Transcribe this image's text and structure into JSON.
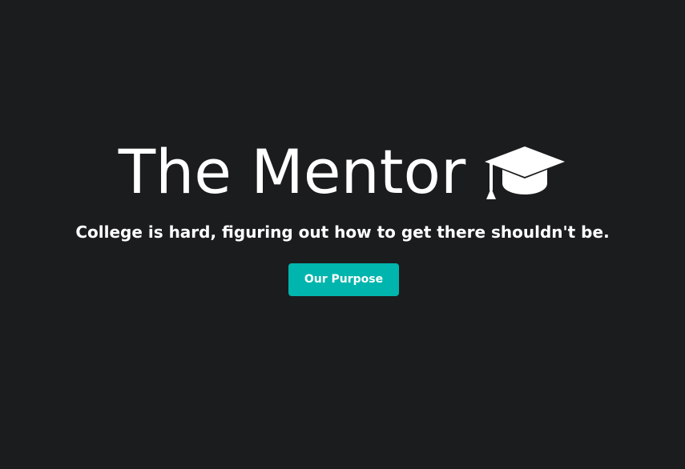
{
  "hero": {
    "title": "The Mentor",
    "title_icon": "graduation-cap-icon",
    "subtitle": "College is hard, figuring out how to get there shouldn't be.",
    "button_label": "Our Purpose"
  },
  "colors": {
    "background": "#1b1c1e",
    "text": "#ffffff",
    "accent": "#00b5ad"
  }
}
